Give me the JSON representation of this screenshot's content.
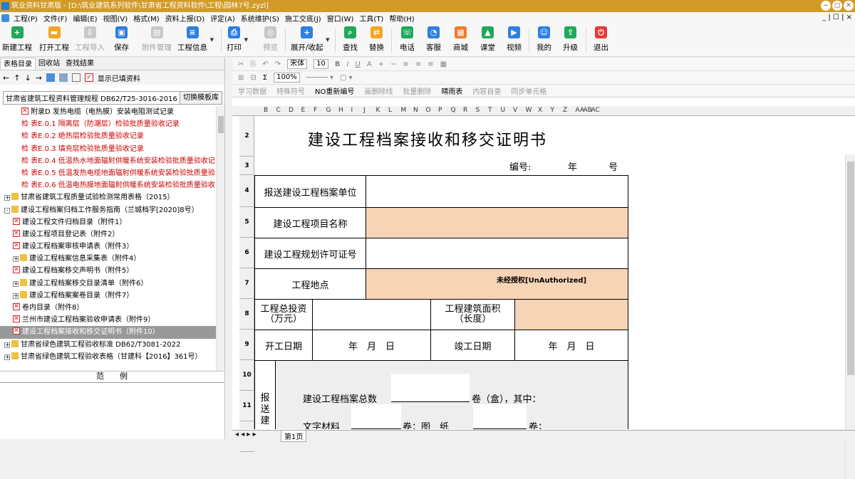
{
  "titlebar": {
    "text": "筑业资料甘肃版 - [D:\\筑业建筑系列软件\\甘肃省工程资料软件\\工程\\园林7号.zyzl]"
  },
  "menu": [
    "工程(P)",
    "文件(F)",
    "编辑(E)",
    "视图(V)",
    "格式(M)",
    "资料上报(D)",
    "评定(A)",
    "系统维护(S)",
    "施工交底(J)",
    "窗口(W)",
    "工具(T)",
    "帮助(H)"
  ],
  "mdi_controls": "_ | ☐ | ×",
  "toolbar": {
    "new": "新建工程",
    "open": "打开工程",
    "import": "工程导入",
    "save": "保存",
    "attach": "附件管理",
    "info": "工程信息",
    "print": "打印",
    "preview": "预览",
    "expand": "展开/收起",
    "find": "查找",
    "replace": "替换",
    "phone": "电话",
    "service": "客服",
    "mall": "商城",
    "class": "课堂",
    "video": "视频",
    "mine": "我的",
    "upgrade": "升级",
    "exit": "退出"
  },
  "left": {
    "tabs": [
      "表格目录",
      "回收站",
      "查找结果"
    ],
    "show_filled": "显示已填资料",
    "spec": "甘肃省建筑工程资料管理规程 DB62/T25-3016-2016",
    "switch_template": "切换模板库",
    "tree": [
      {
        "text": "附录D 发热电缆（电热膜）安装电阻测试记录",
        "icon": "red",
        "indent": 2
      },
      {
        "text": "检 表E.0.1 隔离层（防潮层）检验批质量验收记录",
        "icon": "jian",
        "indent": 2
      },
      {
        "text": "检 表E.0.2 绝热层检验批质量验收记录",
        "icon": "jian",
        "indent": 2
      },
      {
        "text": "检 表E.0.3 填充层检验批质量验收记录",
        "icon": "jian",
        "indent": 2
      },
      {
        "text": "检 表E.0.4 低温热水地面辐射供暖系统安装检验批质量验收记",
        "icon": "jian",
        "indent": 2
      },
      {
        "text": "检 表E.0.5 低温发热电缆地面辐射供暖系统安装检验批质量验",
        "icon": "jian",
        "indent": 2
      },
      {
        "text": "检 表E.0.6 低温电热膜地面辐射供暖系统安装检验批质量验收",
        "icon": "jian",
        "indent": 2
      },
      {
        "text": "甘肃省建筑工程质量试验检测常用表格（2015）",
        "icon": "fold",
        "indent": 0,
        "exp": "+"
      },
      {
        "text": "建设工程档案归档工作服务指南（兰城档字[2020]8号）",
        "icon": "fold",
        "indent": 0,
        "exp": "-"
      },
      {
        "text": "建设工程文件归档目录（附件1）",
        "icon": "red",
        "indent": 1
      },
      {
        "text": "建设工程项目登记表（附件2）",
        "icon": "red",
        "indent": 1
      },
      {
        "text": "建设工程档案审核申请表（附件3）",
        "icon": "red",
        "indent": 1
      },
      {
        "text": "建设工程档案信息采集表（附件4）",
        "icon": "fold",
        "indent": 1,
        "exp": "+"
      },
      {
        "text": "建设工程档案移交声明书（附件5）",
        "icon": "red",
        "indent": 1
      },
      {
        "text": "建设工程档案移交目录清单（附件6）",
        "icon": "fold",
        "indent": 1,
        "exp": "+"
      },
      {
        "text": "建设工程档案案卷目录（附件7）",
        "icon": "fold",
        "indent": 1,
        "exp": "+"
      },
      {
        "text": "卷内目录（附件8）",
        "icon": "red",
        "indent": 1
      },
      {
        "text": "兰州市建设工程档案验收申请表（附件9）",
        "icon": "red",
        "indent": 1
      },
      {
        "text": "建设工程档案接收和移交证明书（附件10）",
        "icon": "red",
        "indent": 1,
        "selected": true
      },
      {
        "text": "甘肃省绿色建筑工程验收标准 DB62/T3081-2022",
        "icon": "fold",
        "indent": 0,
        "exp": "+"
      },
      {
        "text": "甘肃省绿色建筑工程验收表格（甘建科【2016】361号）",
        "icon": "fold",
        "indent": 0,
        "exp": "+"
      }
    ],
    "preview_header": "范　　例"
  },
  "fmt": {
    "font": "宋体",
    "size": "10",
    "zoom": "100%"
  },
  "ext": [
    "学习数据",
    "特殊符号",
    "NO重新编号",
    "画删除线",
    "批量删除",
    "晴雨表",
    "内容自查",
    "同步单元格"
  ],
  "columns": [
    "B",
    "C",
    "D",
    "E",
    "F",
    "G",
    "H",
    "I",
    "J",
    "K",
    "L",
    "M",
    "N",
    "O",
    "P",
    "Q",
    "R",
    "S",
    "T",
    "U",
    "V",
    "W",
    "X",
    "Y",
    "Z",
    "AA",
    "AB",
    "AC"
  ],
  "rows": [
    "2",
    "3",
    "4",
    "5",
    "6",
    "7",
    "8",
    "9",
    "10",
    "11",
    "12"
  ],
  "form": {
    "title": "建设工程档案接收和移交证明书",
    "number_label": "编号:",
    "year": "年",
    "hao": "号",
    "unit": "报送建设工程档案单位",
    "project": "建设工程项目名称",
    "permit": "建设工程规划许可证号",
    "site": "工程地点",
    "watermark": "未经授权[UnAuthorized]",
    "invest": "工程总投资\n（万元）",
    "area": "工程建筑面积\n（长度）",
    "start": "开工日期",
    "ymd": "年　月　日",
    "end": "竣工日期",
    "total": "建设工程档案总数",
    "juan_he": "卷（盒），其中：",
    "text_mat": "文字材料",
    "juan_tu": "卷：图　纸",
    "juan_end": "卷；",
    "side": "报\n送\n建"
  },
  "sheet_tab": "第1页"
}
